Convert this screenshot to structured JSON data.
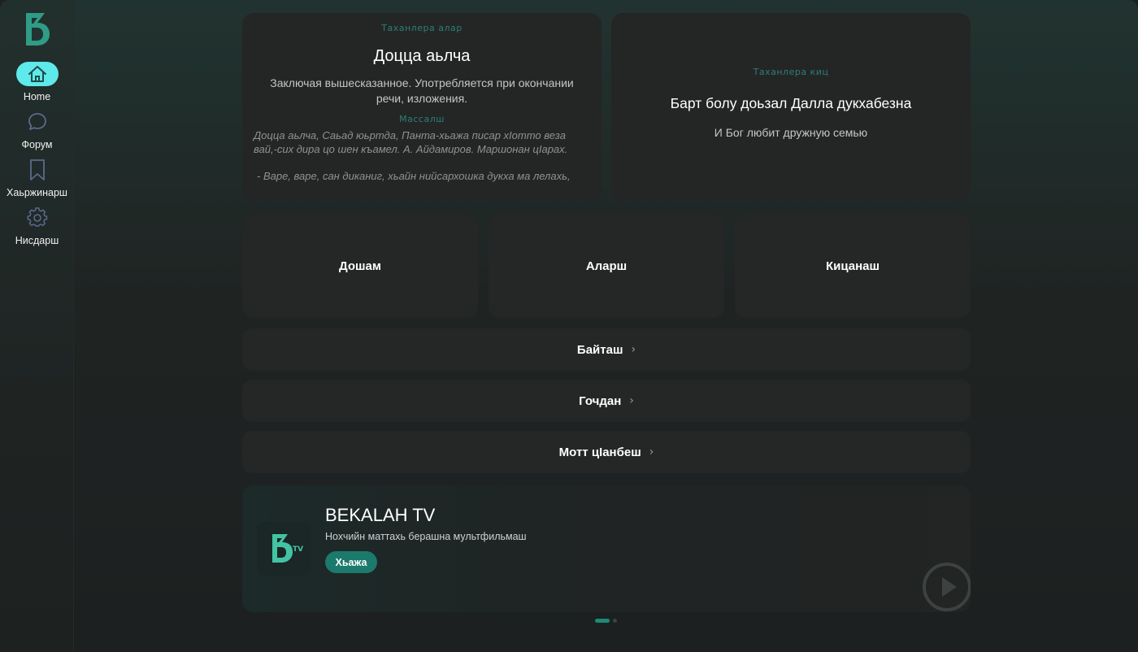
{
  "sidebar": {
    "logo": "bekalah-logo",
    "items": [
      {
        "label": "Home",
        "icon": "home-icon",
        "active": true
      },
      {
        "label": "Форум",
        "icon": "chat-bubble-icon",
        "active": false
      },
      {
        "label": "Хаьржинарш",
        "icon": "bookmark-icon",
        "active": false
      },
      {
        "label": "Нисдарш",
        "icon": "gear-icon",
        "active": false
      }
    ]
  },
  "phrase_card": {
    "eyebrow": "Таханлера алар",
    "title": "Доцца аьлча",
    "meaning": "Заключая вышесказанное. Употребляется при окончании речи, изложения.",
    "example_heading": "Массалш",
    "example_1": "Доцца аьлча, Саьад юьртда, Панта-хьажа писар хIотто веза вай,-сих дира цо шен къамел. А. Айдамиров. Маршонан цIарах.",
    "example_2": "- Варе, варе, сан диканиг, хьайн нийсархошка дукха ма лелахь,"
  },
  "proverb_card": {
    "eyebrow": "Таханлера киц",
    "title": "Барт болу доьзал Далла дукхабезна",
    "translation": "И Бог любит дружную семью"
  },
  "tiles": [
    {
      "label": "Дошам"
    },
    {
      "label": "Аларш"
    },
    {
      "label": "Кицанаш"
    }
  ],
  "rows": [
    {
      "label": "Байташ"
    },
    {
      "label": "Гочдан"
    },
    {
      "label": "Мотт цIанбеш"
    }
  ],
  "banner": {
    "title": "BEKALAH TV",
    "subtitle": "Нохчийн маттахь берашна мультфильмаш",
    "button": "Хьажа"
  },
  "colors": {
    "accent": "#5ee9ea",
    "brand_green": "#1b7a6c",
    "eyebrow": "#2e7f72",
    "card": "#252626"
  },
  "carousel": {
    "pages": 2,
    "current": 1
  }
}
